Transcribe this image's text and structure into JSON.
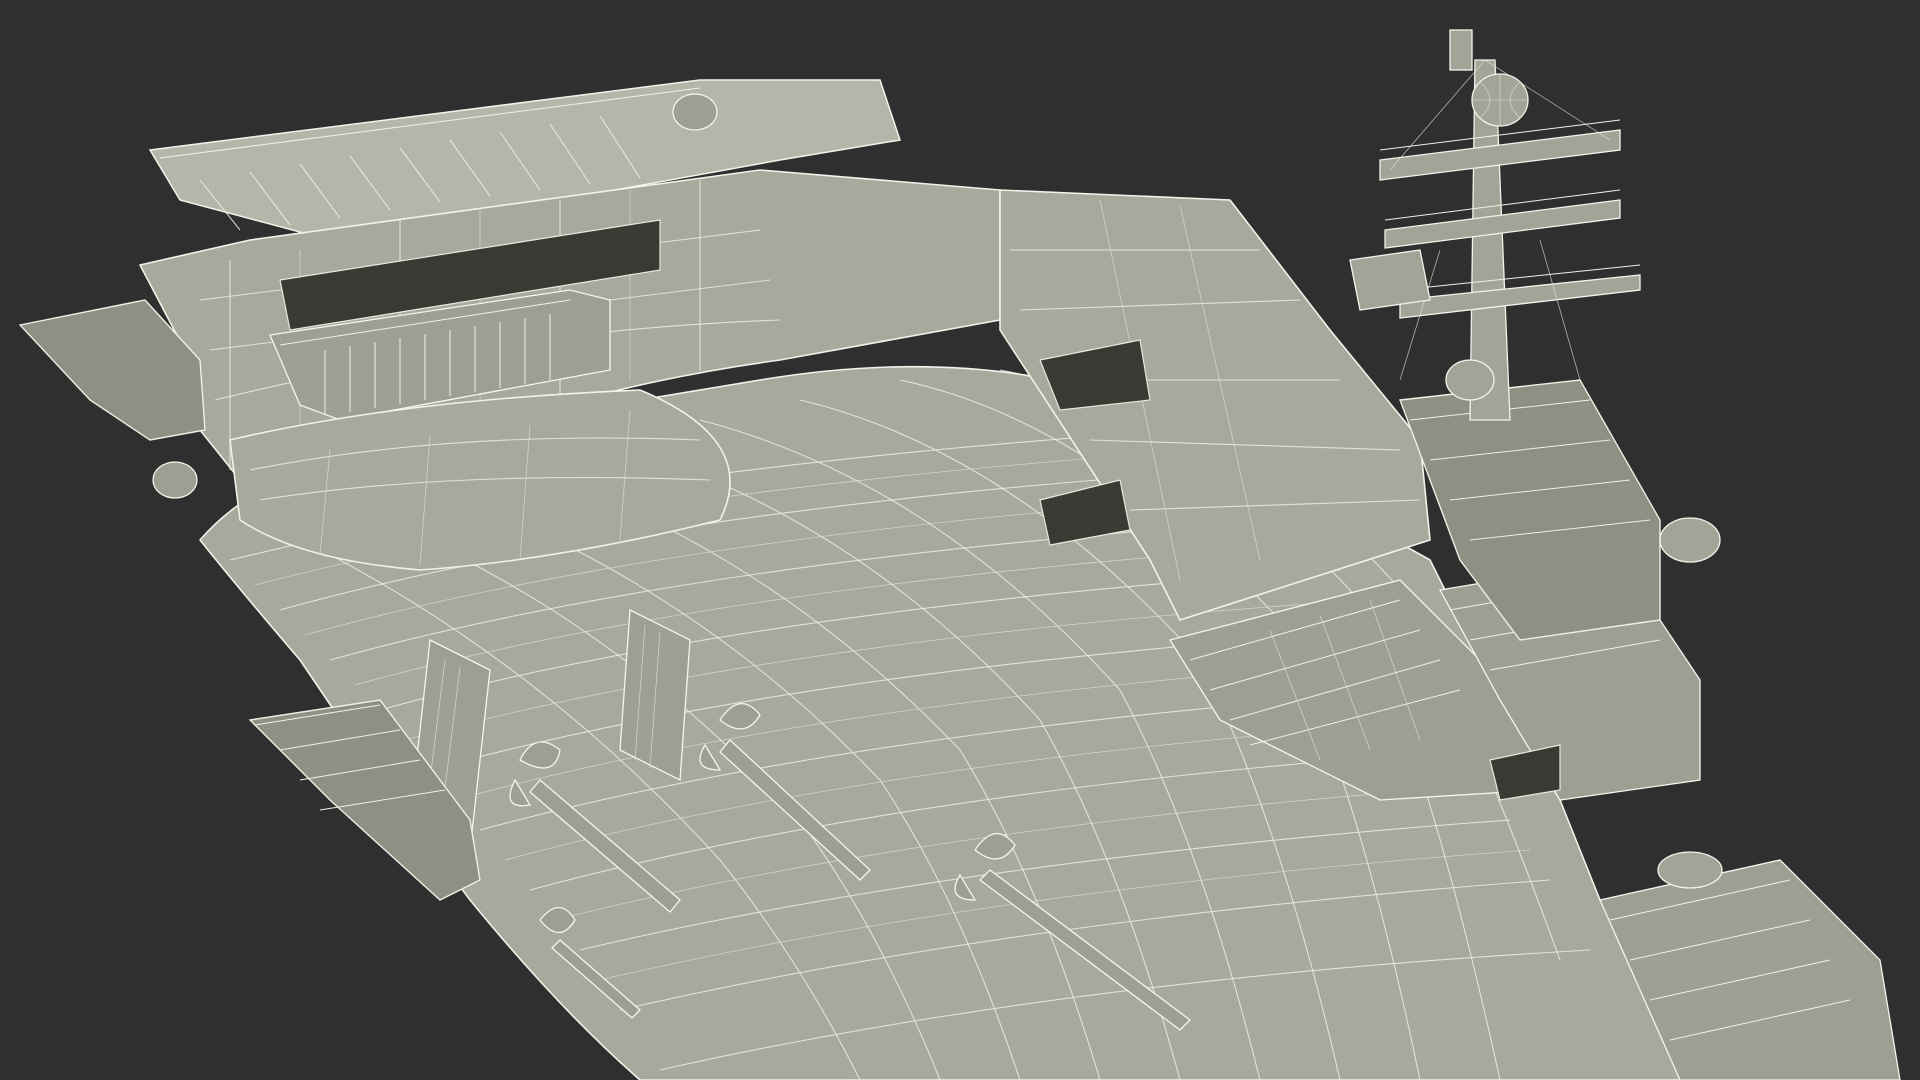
{
  "scene": {
    "background_color": "#2f2f2f",
    "model_color": "#a8a89c",
    "wireframe_color": "#f2f2ea"
  }
}
